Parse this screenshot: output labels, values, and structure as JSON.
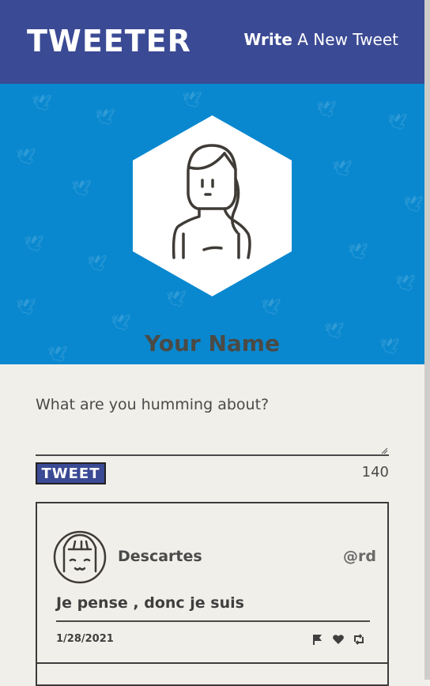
{
  "header": {
    "brand": "TWEETER",
    "write_bold": "Write",
    "write_rest": " A New Tweet"
  },
  "profile": {
    "name": "Your Name",
    "avatar_icon": "woman-avatar-icon",
    "banner_color": "#0a88cf"
  },
  "composer": {
    "placeholder": "What are you humming about?",
    "value": "",
    "button_label": "TWEET",
    "char_count": "140"
  },
  "tweets": [
    {
      "author": "Descartes",
      "handle": "@rd",
      "text": "Je pense , donc je suis",
      "date": "1/28/2021",
      "actions": [
        "flag-icon",
        "heart-icon",
        "retweet-icon"
      ]
    }
  ],
  "colors": {
    "header": "#3b4a94",
    "page_bg": "#f1efe9",
    "text": "#4a4a4a"
  }
}
